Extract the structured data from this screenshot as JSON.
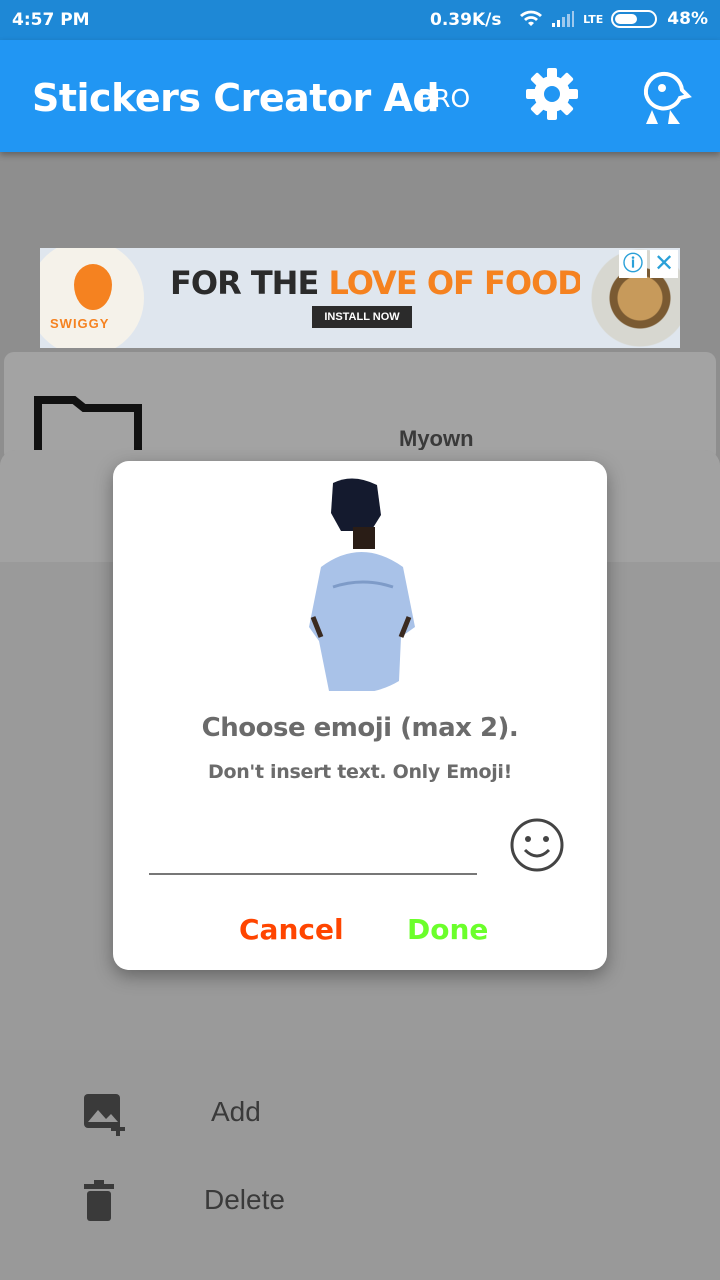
{
  "status_bar": {
    "time": "4:57 PM",
    "network_speed": "0.39K/s",
    "network_type": "LTE",
    "battery": "48%"
  },
  "app_bar": {
    "title": "Stickers Creator Ad",
    "pro_label": "PRO",
    "icons": [
      "gear-icon",
      "mascot-icon"
    ]
  },
  "ad": {
    "brand": "SWIGGY",
    "headline_part1": "FOR THE ",
    "headline_part2": "LOVE OF FOOD!",
    "cta": "INSTALL NOW",
    "info_symbol": "ⓘ",
    "close_symbol": "✕"
  },
  "pack": {
    "name": "Myown"
  },
  "dialog": {
    "heading": "Choose emoji (max 2).",
    "subtitle": "Don't insert text. Only Emoji!",
    "input_value": "",
    "cancel_label": "Cancel",
    "done_label": "Done",
    "colors": {
      "cancel": "#ff4500",
      "done": "#6bff2b"
    }
  },
  "actions": [
    {
      "label": "Add",
      "icon": "add-image-icon"
    },
    {
      "label": "Delete",
      "icon": "trash-icon"
    }
  ],
  "colors": {
    "app_bar": "#2196f3",
    "status_bar": "#1e88d6"
  }
}
